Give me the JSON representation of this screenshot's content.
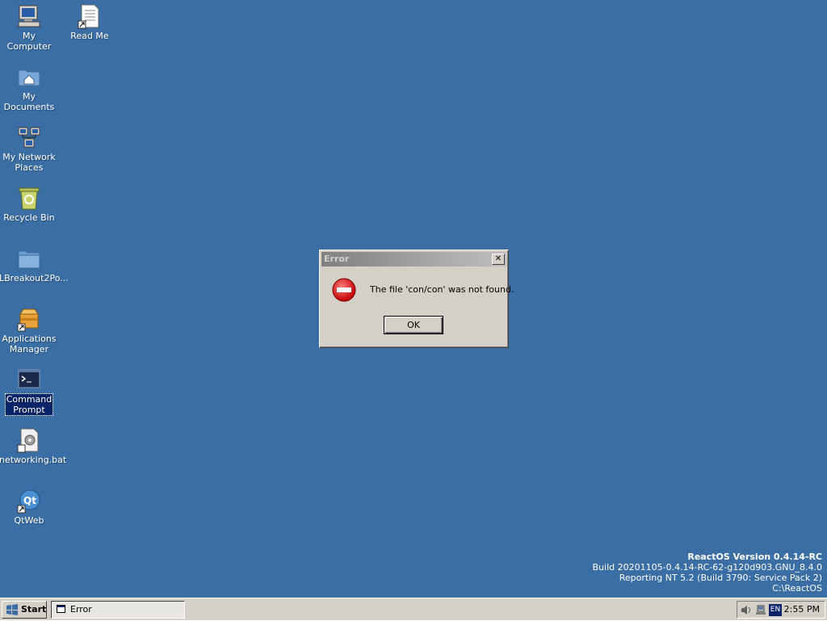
{
  "desktop": {
    "background_color": "#3a6ea5",
    "icons": [
      {
        "label": "My\nComputer",
        "icon": "computer-icon"
      },
      {
        "label": "Read Me",
        "icon": "document-shortcut-icon"
      },
      {
        "label": "My\nDocuments",
        "icon": "documents-folder-icon"
      },
      {
        "label": "My Network\nPlaces",
        "icon": "network-places-icon"
      },
      {
        "label": "Recycle Bin",
        "icon": "recycle-bin-icon"
      },
      {
        "label": "LBreakout2Po...",
        "icon": "folder-icon"
      },
      {
        "label": "Applications\nManager",
        "icon": "applications-manager-icon"
      },
      {
        "label": "Command\nPrompt",
        "icon": "command-prompt-icon"
      },
      {
        "label": "networking.bat",
        "icon": "batch-file-icon"
      },
      {
        "label": "QtWeb",
        "icon": "qtweb-icon"
      }
    ]
  },
  "dialog": {
    "title": "Error",
    "close_label": "✕",
    "message": "The file 'con/con' was not found.",
    "ok_label": "OK",
    "icon": "error-stop-icon"
  },
  "version_info": {
    "title": "ReactOS Version 0.4.14-RC",
    "build": "Build 20201105-0.4.14-RC-62-g120d903.GNU_8.4.0",
    "reporting": "Reporting NT 5.2 (Build 3790: Service Pack 2)",
    "path": "C:\\ReactOS"
  },
  "taskbar": {
    "start_label": "Start",
    "tasks": [
      {
        "label": "Error",
        "active": true
      }
    ],
    "tray": {
      "volume_icon": "speaker-icon",
      "network_icon": "network-tray-icon",
      "language": "EN",
      "clock": "2:55 PM"
    }
  }
}
